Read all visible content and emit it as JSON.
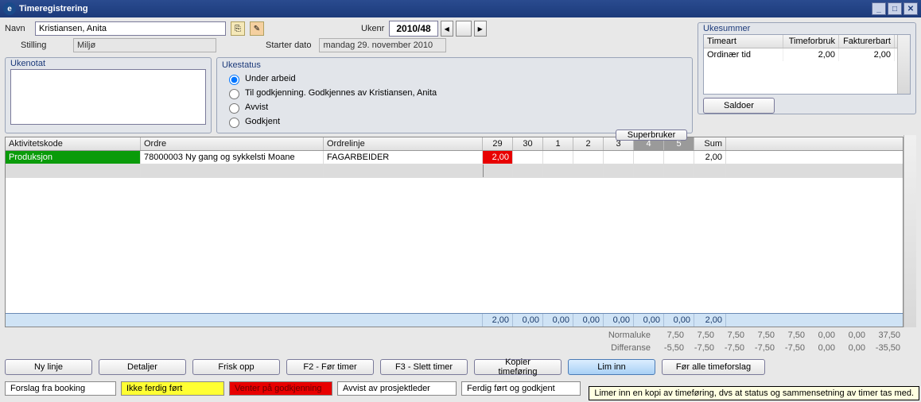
{
  "window": {
    "title": "Timeregistrering"
  },
  "header": {
    "navn_label": "Navn",
    "navn_value": "Kristiansen, Anita",
    "stilling_label": "Stilling",
    "stilling_value": "Miljø",
    "ukenr_label": "Ukenr",
    "ukenr_value": "2010/48",
    "startdato_label": "Starter dato",
    "startdato_value": "mandag 29. november 2010"
  },
  "notat": {
    "title": "Ukenotat",
    "value": ""
  },
  "status": {
    "title": "Ukestatus",
    "options": {
      "under_arbeid": "Under arbeid",
      "godkjenning": "Til godkjenning. Godkjennes av Kristiansen, Anita",
      "avvist": "Avvist",
      "godkjent": "Godkjent"
    },
    "selected": "under_arbeid",
    "super_btn": "Superbruker"
  },
  "ukesum": {
    "title": "Ukesummer",
    "cols": {
      "timeart": "Timeart",
      "timeforbruk": "Timeforbruk",
      "fakturerbart": "Fakturerbart"
    },
    "row": {
      "timeart": "Ordinær tid",
      "timeforbruk": "2,00",
      "fakturerbart": "2,00"
    },
    "saldoer_btn": "Saldoer"
  },
  "grid": {
    "cols": {
      "aktivitet": "Aktivitetskode",
      "ordre": "Ordre",
      "linje": "Ordrelinje",
      "sum": "Sum"
    },
    "days": [
      "29",
      "30",
      "1",
      "2",
      "3",
      "4",
      "5"
    ],
    "row": {
      "aktivitet": "Produksjon",
      "ordre": "78000003 Ny gang og sykkelsti Moane",
      "linje": "FAGARBEIDER",
      "d29": "2,00",
      "sum": "2,00"
    },
    "totals": [
      "2,00",
      "0,00",
      "0,00",
      "0,00",
      "0,00",
      "0,00",
      "0,00",
      "2,00"
    ],
    "normal_label": "Normaluke",
    "normal": [
      "7,50",
      "7,50",
      "7,50",
      "7,50",
      "7,50",
      "0,00",
      "0,00",
      "37,50"
    ],
    "diff_label": "Differanse",
    "diff": [
      "-5,50",
      "-7,50",
      "-7,50",
      "-7,50",
      "-7,50",
      "0,00",
      "0,00",
      "-35,50"
    ]
  },
  "buttons": {
    "ny": "Ny linje",
    "detaljer": "Detaljer",
    "frisk": "Frisk opp",
    "f2": "F2 - Før timer",
    "f3": "F3 - Slett timer",
    "kopier": "Kopier timeføring",
    "lim": "Lim inn",
    "alle": "Før alle timeforslag"
  },
  "legend": {
    "booking": "Forslag fra booking",
    "ikke": "Ikke ferdig ført",
    "venter": "Venter på godkjenning",
    "avvist": "Avvist av prosjektleder",
    "ferdig": "Ferdig ført og godkjent"
  },
  "colors": {
    "yellow": "#ffff33",
    "red": "#e80000",
    "blue": "#cfe3f5",
    "green": "#0a9b0a"
  },
  "tooltip": "Limer inn en kopi av timeføring, dvs at status og sammensetning av timer tas med."
}
